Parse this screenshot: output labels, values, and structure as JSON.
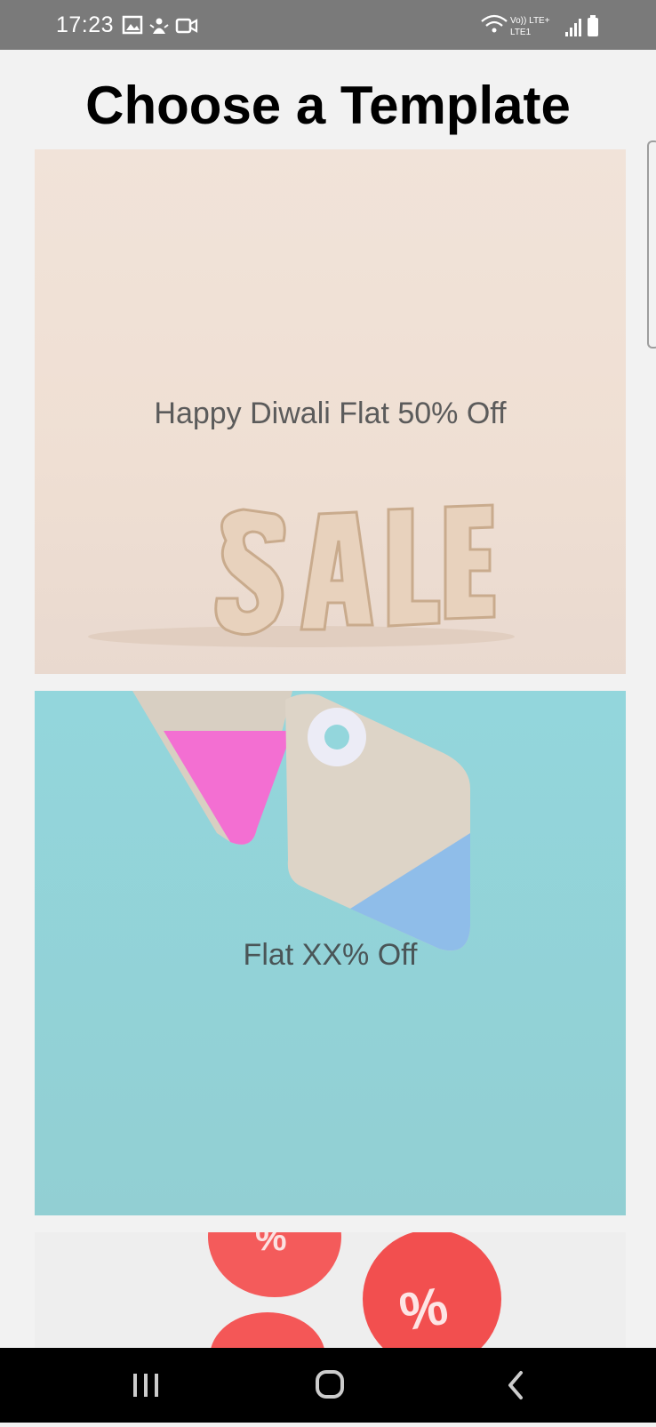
{
  "status_bar": {
    "time": "17:23",
    "network_top": "Vo)) LTE+",
    "network_bottom": "LTE1",
    "left_icons": [
      "gallery-icon",
      "usb-debug-icon",
      "video-icon"
    ],
    "right_icons": [
      "wifi-icon",
      "signal-icon",
      "battery-icon"
    ]
  },
  "title": "Choose a Template",
  "templates": [
    {
      "text": "Happy Diwali Flat 50% Off",
      "image": "wooden SALE letters on beige background",
      "bg": "#f0e2d8"
    },
    {
      "text": "Flat XX% Off",
      "image": "price tags on teal background",
      "bg": "#93d4d9"
    },
    {
      "text": "",
      "image": "red percent balloons",
      "bg": "#eeeeee"
    }
  ],
  "nav_bar": {
    "buttons": [
      "recents-button",
      "home-button",
      "back-button"
    ]
  },
  "colors": {
    "status_bar": "#7a7a7a",
    "page_background": "#f2f2f2",
    "nav_bar": "#000000"
  }
}
